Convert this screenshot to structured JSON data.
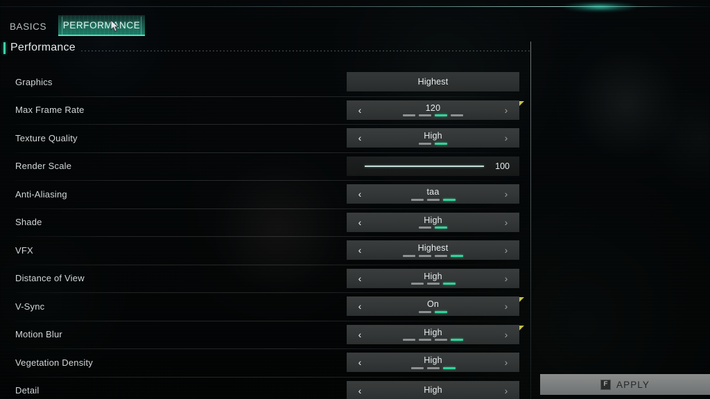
{
  "tabs": [
    {
      "label": "BASICS",
      "active": false
    },
    {
      "label": "PERFORMANCE",
      "active": true
    }
  ],
  "section": {
    "title": "Performance",
    "accent_color": "#3fcfa8"
  },
  "colors": {
    "accent_teal": "#2fd49a",
    "step_off": "#8c9191",
    "marker_yellow": "#d8d44a",
    "tab_active_bg": "#208a70",
    "panel_bg": "#343737"
  },
  "icons": {
    "arrow_left": "‹",
    "arrow_right": "›",
    "apply_key": "F"
  },
  "settings": [
    {
      "label": "Graphics",
      "type": "button",
      "value": "Highest",
      "steps_total": 0,
      "step_active": 0,
      "marker": false
    },
    {
      "label": "Max Frame Rate",
      "type": "stepper",
      "value": "120",
      "steps_total": 4,
      "step_active": 3,
      "marker": true
    },
    {
      "label": "Texture Quality",
      "type": "stepper",
      "value": "High",
      "steps_total": 2,
      "step_active": 2,
      "marker": false
    },
    {
      "label": "Render Scale",
      "type": "slider",
      "value": "100",
      "fill_percent": 100,
      "steps_total": 0,
      "step_active": 0,
      "marker": false
    },
    {
      "label": "Anti-Aliasing",
      "type": "stepper",
      "value": "taa",
      "steps_total": 3,
      "step_active": 3,
      "marker": false
    },
    {
      "label": "Shade",
      "type": "stepper",
      "value": "High",
      "steps_total": 2,
      "step_active": 2,
      "marker": false
    },
    {
      "label": "VFX",
      "type": "stepper",
      "value": "Highest",
      "steps_total": 4,
      "step_active": 4,
      "marker": false
    },
    {
      "label": "Distance of View",
      "type": "stepper",
      "value": "High",
      "steps_total": 3,
      "step_active": 3,
      "marker": false
    },
    {
      "label": "V-Sync",
      "type": "stepper",
      "value": "On",
      "steps_total": 2,
      "step_active": 2,
      "marker": true
    },
    {
      "label": "Motion Blur",
      "type": "stepper",
      "value": "High",
      "steps_total": 4,
      "step_active": 4,
      "marker": true
    },
    {
      "label": "Vegetation Density",
      "type": "stepper",
      "value": "High",
      "steps_total": 3,
      "step_active": 3,
      "marker": false
    },
    {
      "label": "Detail",
      "type": "stepper",
      "value": "High",
      "steps_total": 0,
      "step_active": 0,
      "marker": false
    }
  ],
  "apply": {
    "key": "F",
    "label": "APPLY"
  }
}
